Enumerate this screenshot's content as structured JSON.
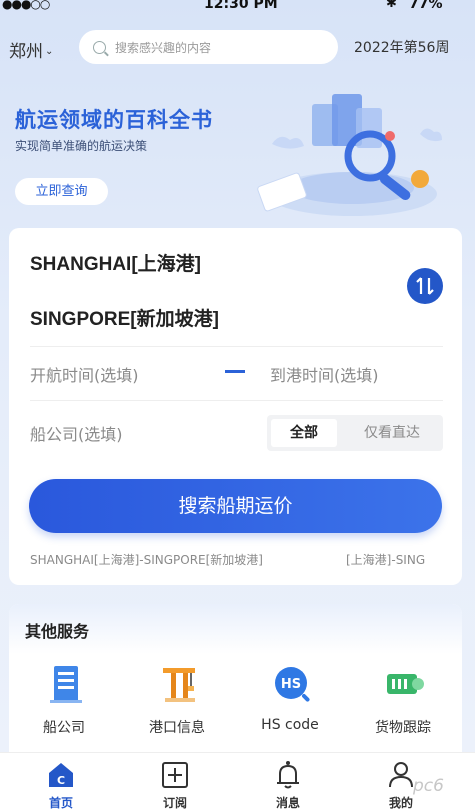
{
  "status_bar": {
    "signal": "●●●○○",
    "time": "12:30 PM",
    "bluetooth": "✱",
    "battery": "77%"
  },
  "header": {
    "city": "郑州",
    "search_placeholder": "搜索感兴趣的内容",
    "week_label": "2022年第56周"
  },
  "banner": {
    "title": "航运领域的百科全书",
    "subtitle": "实现简单准确的航运决策",
    "button": "立即查询"
  },
  "search_card": {
    "origin": "SHANGHAI[上海港]",
    "destination": "SINGPORE[新加坡港]",
    "depart_placeholder": "开航时间(选填)",
    "arrive_placeholder": "到港时间(选填)",
    "carrier_placeholder": "船公司(选填)",
    "filter_options": [
      "全部",
      "仅看直达"
    ],
    "filter_selected": "全部",
    "search_button": "搜索船期运价",
    "history": [
      "SHANGHAI[上海港]-SINGPORE[新加坡港]",
      "[上海港]-SING"
    ]
  },
  "services": {
    "title": "其他服务",
    "items": [
      {
        "label": "船公司",
        "icon": "building-icon"
      },
      {
        "label": "港口信息",
        "icon": "crane-icon"
      },
      {
        "label": "HS code",
        "icon": "hs-code-icon"
      },
      {
        "label": "货物跟踪",
        "icon": "cargo-track-icon"
      }
    ]
  },
  "tabbar": {
    "items": [
      {
        "label": "首页",
        "icon": "home-icon",
        "active": true
      },
      {
        "label": "订阅",
        "icon": "subscribe-icon",
        "active": false
      },
      {
        "label": "消息",
        "icon": "bell-icon",
        "active": false
      },
      {
        "label": "我的",
        "icon": "profile-icon",
        "active": false
      }
    ]
  },
  "watermark": "pc6",
  "colors": {
    "accent": "#2b62d8",
    "button_gradient_start": "#2a58dc",
    "button_gradient_end": "#3c73ea"
  }
}
